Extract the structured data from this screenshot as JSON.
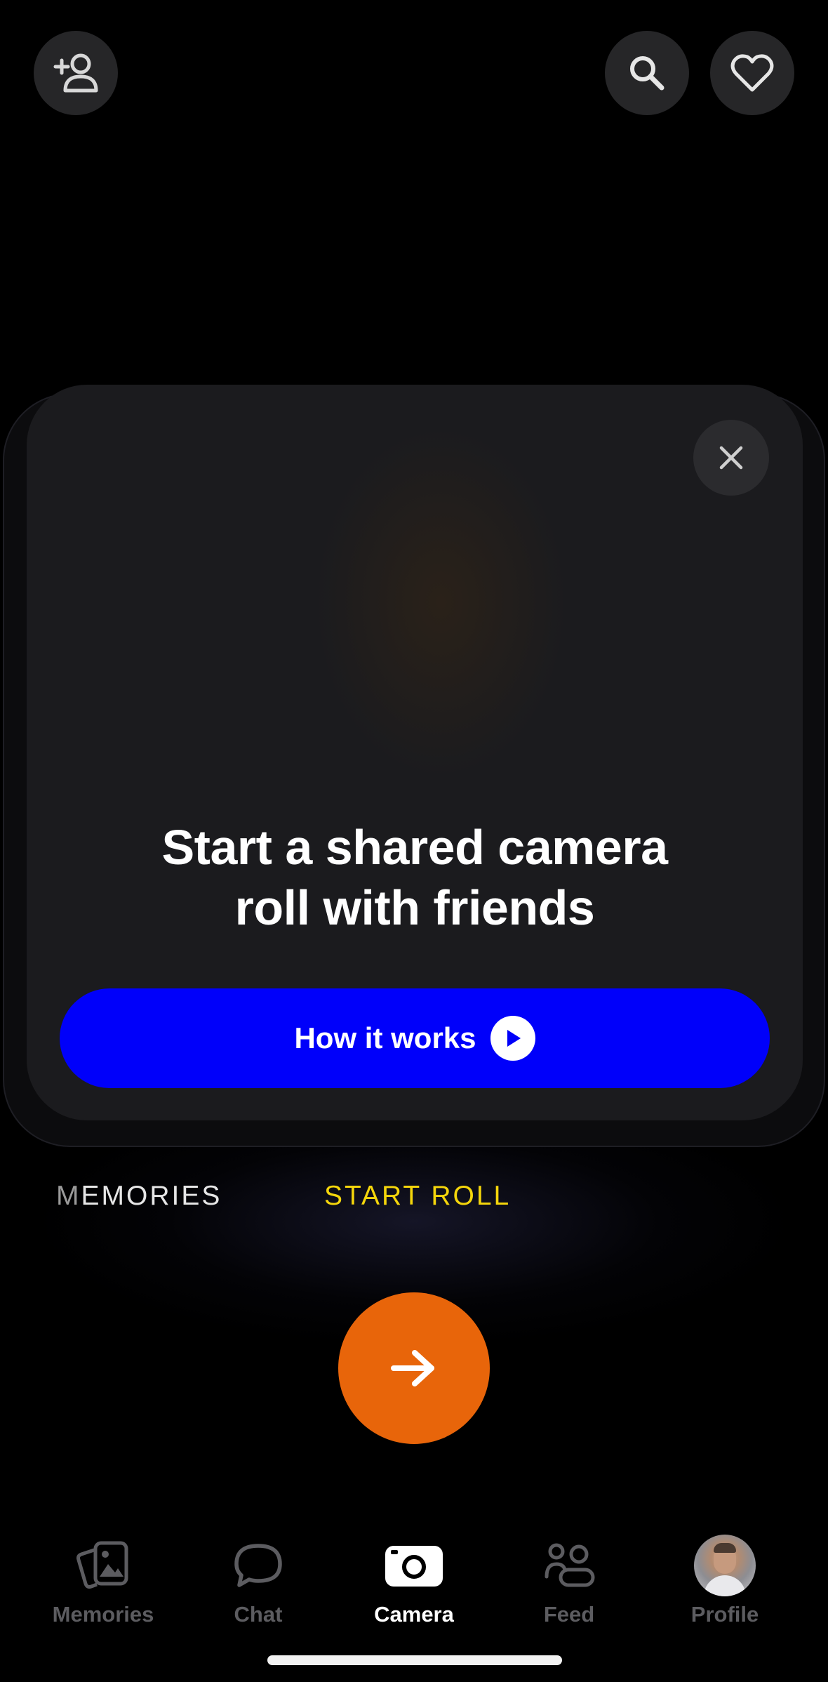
{
  "header": {
    "add_friend_icon": "add-friend-icon",
    "search_icon": "search-icon",
    "favorites_icon": "heart-icon"
  },
  "promo_card": {
    "title": "Start a shared camera\nroll with friends",
    "button_label": "How it works",
    "close_icon": "close-icon",
    "play_icon": "play-icon",
    "button_color": "#0000fa"
  },
  "modes": {
    "left_first_letter": "M",
    "left_rest": "EMORIES",
    "active": "START ROLL",
    "active_color": "#f5d60b"
  },
  "shutter": {
    "icon": "arrow-right-icon",
    "color": "#e8650a"
  },
  "nav": {
    "items": [
      {
        "label": "Memories",
        "icon": "memories-icon"
      },
      {
        "label": "Chat",
        "icon": "chat-icon"
      },
      {
        "label": "Camera",
        "icon": "camera-icon"
      },
      {
        "label": "Feed",
        "icon": "feed-icon"
      },
      {
        "label": "Profile",
        "icon": "avatar"
      }
    ],
    "active_index": 2
  }
}
